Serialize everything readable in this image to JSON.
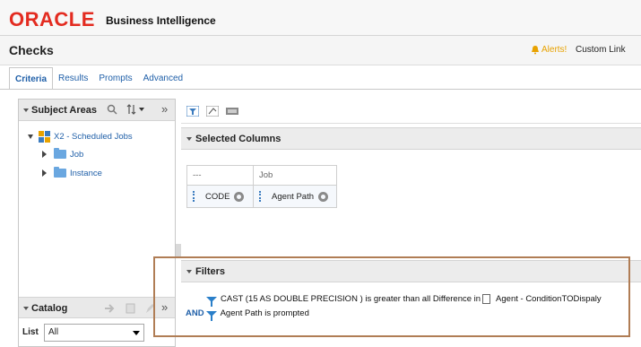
{
  "header": {
    "logo_text": "ORACLE",
    "product_name": "Business Intelligence"
  },
  "page": {
    "title": "Checks",
    "alerts_label": "Alerts!",
    "custom_link_label": "Custom Link"
  },
  "tabs": [
    {
      "label": "Criteria",
      "active": true
    },
    {
      "label": "Results",
      "active": false
    },
    {
      "label": "Prompts",
      "active": false
    },
    {
      "label": "Advanced",
      "active": false
    }
  ],
  "subject_areas": {
    "title": "Subject Areas",
    "root": "X2 - Scheduled Jobs",
    "items": [
      "Job",
      "Instance"
    ]
  },
  "catalog": {
    "title": "Catalog",
    "list_label": "List",
    "list_value": "All"
  },
  "selected_columns": {
    "title": "Selected Columns",
    "columns": [
      {
        "group": "---",
        "name": "CODE"
      },
      {
        "group": "Job",
        "name": "Agent Path"
      }
    ]
  },
  "filters": {
    "title": "Filters",
    "line1_text": "CAST (15 AS DOUBLE PRECISION ) is greater than all  Difference in",
    "line1_tail": "Agent - ConditionTODispaly",
    "operator": "AND",
    "line2_text": "Agent Path is prompted"
  },
  "colors": {
    "accent": "#1f5fa8",
    "oracle_red": "#e32b20",
    "highlight_border": "#b07d55"
  }
}
